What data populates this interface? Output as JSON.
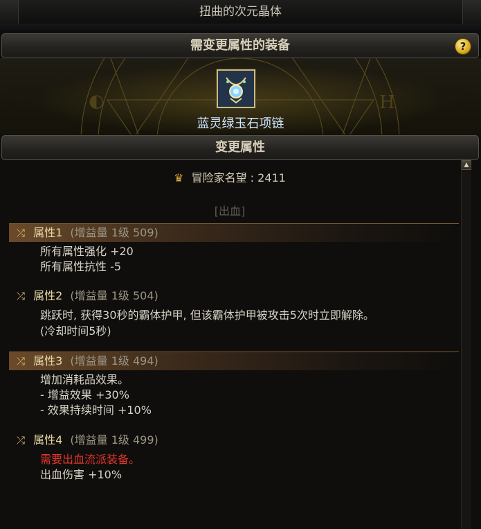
{
  "window": {
    "title": "扭曲的次元晶体"
  },
  "sections": {
    "equipment_header": "需变更属性的装备",
    "change_header": "变更属性",
    "help_label": "?"
  },
  "equipment": {
    "icon": "necklace-icon",
    "name": "蓝灵绿玉石项链"
  },
  "fame": {
    "label": "冒险家名望 :",
    "value": "2411",
    "icon": "laurel-crown-icon"
  },
  "tag": "[出血]",
  "attributes": [
    {
      "name": "属性1",
      "info": "(增益量 1级 509)",
      "highlighted": true,
      "lines": [
        "所有属性强化 +20",
        "所有属性抗性 -5"
      ]
    },
    {
      "name": "属性2",
      "info": "(增益量 1级 504)",
      "highlighted": false,
      "lines": [
        "跳跃时, 获得30秒的霸体护甲, 但该霸体护甲被攻击5次时立即解除。",
        "(冷却时间5秒)"
      ]
    },
    {
      "name": "属性3",
      "info": "(增益量 1级 494)",
      "highlighted": true,
      "lines": [
        "增加消耗品效果。",
        "- 增益效果 +30%",
        "- 效果持续时间 +10%"
      ]
    },
    {
      "name": "属性4",
      "info": "(增益量 1级 499)",
      "highlighted": false,
      "lines_red": [
        "需要出血流派装备。"
      ],
      "lines": [
        "出血伤害 +10%"
      ]
    }
  ],
  "colors": {
    "accent_gold": "#e0c073",
    "highlight_row": "#6a4a2a",
    "warning_red": "#e2352b",
    "item_name_blue": "#cfe6ff"
  }
}
